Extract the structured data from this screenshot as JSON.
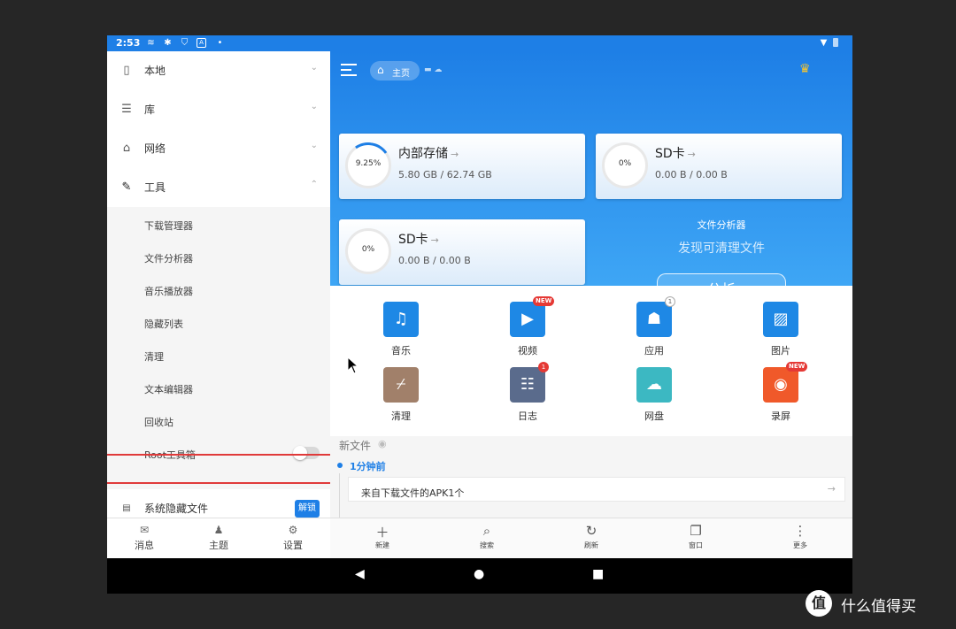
{
  "status_bar": {
    "time": "2:53"
  },
  "drawer": {
    "items": [
      {
        "label": "本地",
        "icon": "phone-icon"
      },
      {
        "label": "库",
        "icon": "layers-icon"
      },
      {
        "label": "网络",
        "icon": "router-icon"
      },
      {
        "label": "工具",
        "icon": "wrench-icon"
      }
    ],
    "tools": [
      "下载管理器",
      "文件分析器",
      "音乐播放器",
      "隐藏列表",
      "清理",
      "文本编辑器",
      "回收站"
    ],
    "root_toolbox": {
      "label": "Root工具箱",
      "enabled": false
    },
    "hidden_files": {
      "label": "系统隐藏文件",
      "unlock": "解锁"
    },
    "bottom": [
      "消息",
      "主题",
      "设置"
    ]
  },
  "header": {
    "home": "主页"
  },
  "storage": [
    {
      "name": "内部存储",
      "percent": "9.25%",
      "size": "5.80 GB / 62.74 GB"
    },
    {
      "name": "SD卡",
      "percent": "0%",
      "size": "0.00 B / 0.00 B"
    },
    {
      "name": "SD卡",
      "percent": "0%",
      "size": "0.00 B / 0.00 B"
    }
  ],
  "analyzer": {
    "title": "文件分析器",
    "subtitle": "发现可清理文件",
    "button": "分析"
  },
  "categories": [
    {
      "label": "音乐",
      "color": "#1e88e5"
    },
    {
      "label": "视频",
      "color": "#1e88e5",
      "badge": "NEW"
    },
    {
      "label": "应用",
      "color": "#1e88e5",
      "badge": "1"
    },
    {
      "label": "图片",
      "color": "#1e88e5"
    },
    {
      "label": "清理",
      "color": "#a1806a"
    },
    {
      "label": "日志",
      "color": "#5a6b8c",
      "badge": "1"
    },
    {
      "label": "网盘",
      "color": "#3cb8c2"
    },
    {
      "label": "录屏",
      "color": "#f0592a",
      "badge": "NEW"
    }
  ],
  "recent": {
    "title": "新文件",
    "time": "1分钟前",
    "item": "来自下载文件的APK1个"
  },
  "toolbar": [
    "新建",
    "搜索",
    "刷新",
    "窗口",
    "更多"
  ],
  "watermark": {
    "logo": "值",
    "text": "什么值得买"
  }
}
